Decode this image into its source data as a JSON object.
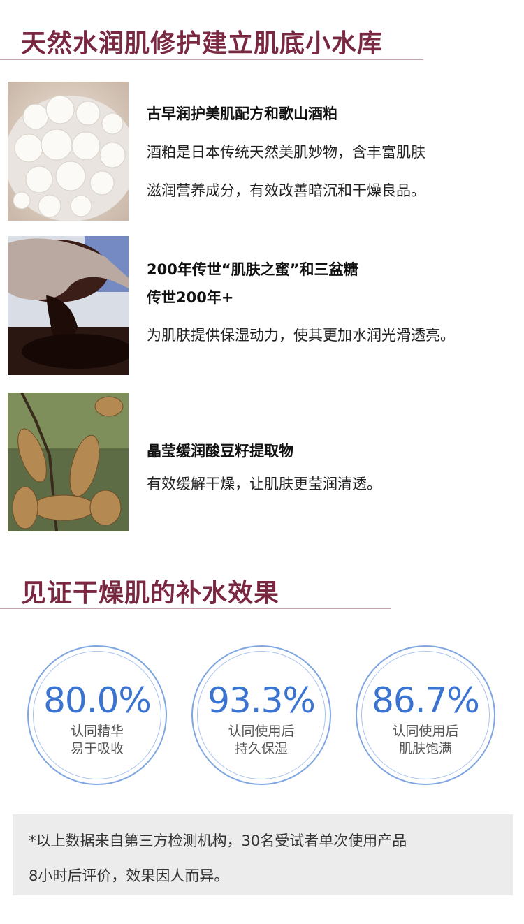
{
  "section1": {
    "title": "天然水润肌修护建立肌底小水库",
    "ingredients": [
      {
        "image_icon": "sake-lees-photo",
        "title_line1": "古早润护美肌配方和歌山酒粕",
        "title_line2": "",
        "desc_line1": "酒粕是日本传统天然美肌妙物，含丰富肌肤",
        "desc_line2": "滋润营养成分，有效改善暗沉和干燥良品。"
      },
      {
        "image_icon": "brown-sugar-syrup-photo",
        "title_line1": "200年传世“肌肤之蜜”和三盆糖",
        "title_line2": "传世200年+",
        "desc_line1": "为肌肤提供保湿动力，使其更加水润光滑透亮。",
        "desc_line2": ""
      },
      {
        "image_icon": "tamarind-pods-photo",
        "title_line1": "晶莹缓润酸豆籽提取物",
        "title_line2": "",
        "desc_line1": "有效缓解干燥，让肌肤更莹润清透。",
        "desc_line2": ""
      }
    ]
  },
  "section2": {
    "title": "见证干燥肌的补水效果",
    "stats": [
      {
        "value": "80.0%",
        "caption_line1": "认同精华",
        "caption_line2": "易于吸收"
      },
      {
        "value": "93.3%",
        "caption_line1": "认同使用后",
        "caption_line2": "持久保湿"
      },
      {
        "value": "86.7%",
        "caption_line1": "认同使用后",
        "caption_line2": "肌肤饱满"
      }
    ],
    "note_line1": "*以上数据来自第三方检测机构，30名受试者单次使用产品",
    "note_line2": "8小时后评价，效果因人而异。"
  },
  "colors": {
    "title": "#7a2842",
    "stat_blue": "#3b74d0",
    "circle_border": "#7fa6e0",
    "note_bg": "#ececec"
  }
}
